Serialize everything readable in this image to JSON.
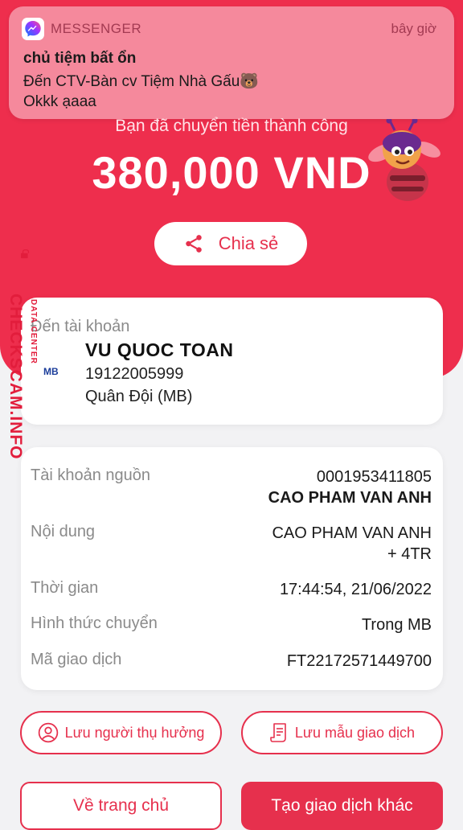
{
  "notification": {
    "app_name": "MESSENGER",
    "time": "bây giờ",
    "title": "chủ tiệm bất ổn",
    "subtitle": "Đến CTV-Bàn cv Tiệm Nhà Gấu🐻",
    "message": "Okkk ạaaa"
  },
  "hero": {
    "success_text": "Bạn đã chuyển tiền thành công",
    "amount": "380,000 VND",
    "share_label": "Chia sẻ"
  },
  "watermark": {
    "site": "CHECKSCAM.INFO",
    "sub": "DATA CENTER"
  },
  "recipient": {
    "label": "Đến tài khoản",
    "bank_logo_text": "MB",
    "name": "VU QUOC TOAN",
    "account": "19122005999",
    "bank": "Quân Đội (MB)"
  },
  "details": {
    "source_label": "Tài khoản nguồn",
    "source_account": "0001953411805",
    "source_name": "CAO PHAM VAN ANH",
    "content_label": "Nội dung",
    "content_line1": "CAO PHAM VAN ANH",
    "content_line2": "+ 4TR",
    "time_label": "Thời gian",
    "time_value": "17:44:54, 21/06/2022",
    "method_label": "Hình thức chuyển",
    "method_value": "Trong MB",
    "txn_label": "Mã giao dịch",
    "txn_value": "FT22172571449700"
  },
  "actions": {
    "save_beneficiary": "Lưu người thụ hưởng",
    "save_template": "Lưu mẫu giao dịch",
    "home": "Về trang chủ",
    "new_transaction": "Tạo giao dịch khác"
  },
  "colors": {
    "brand_red": "#ee2e4d",
    "notification_bg": "#f5899c",
    "mb_blue": "#1b3d9a"
  }
}
